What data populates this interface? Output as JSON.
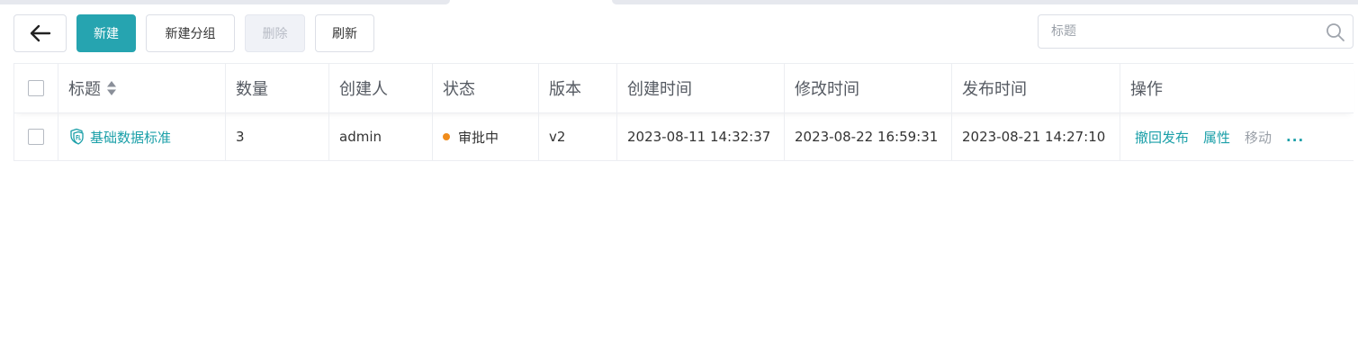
{
  "toolbar": {
    "back_icon": "arrow-left-icon",
    "new_label": "新建",
    "new_group_label": "新建分组",
    "delete_label": "删除",
    "refresh_label": "刷新"
  },
  "search": {
    "placeholder": "标题",
    "value": "",
    "icon": "search-icon"
  },
  "table": {
    "columns": [
      "标题",
      "数量",
      "创建人",
      "状态",
      "版本",
      "创建时间",
      "修改时间",
      "发布时间",
      "操作"
    ],
    "rows": [
      {
        "title": "基础数据标准",
        "count": "3",
        "creator": "admin",
        "status": "审批中",
        "version": "v2",
        "created": "2023-08-11 14:32:37",
        "modified": "2023-08-22 16:59:31",
        "published": "2023-08-21 14:27:10",
        "actions": {
          "revoke": "撤回发布",
          "properties": "属性",
          "move": "移动",
          "more": "..."
        }
      }
    ]
  },
  "colors": {
    "accent": "#26a4b0",
    "link": "#1a9fa8",
    "status_pending": "#f08c1c",
    "muted": "#9aa0a8"
  }
}
